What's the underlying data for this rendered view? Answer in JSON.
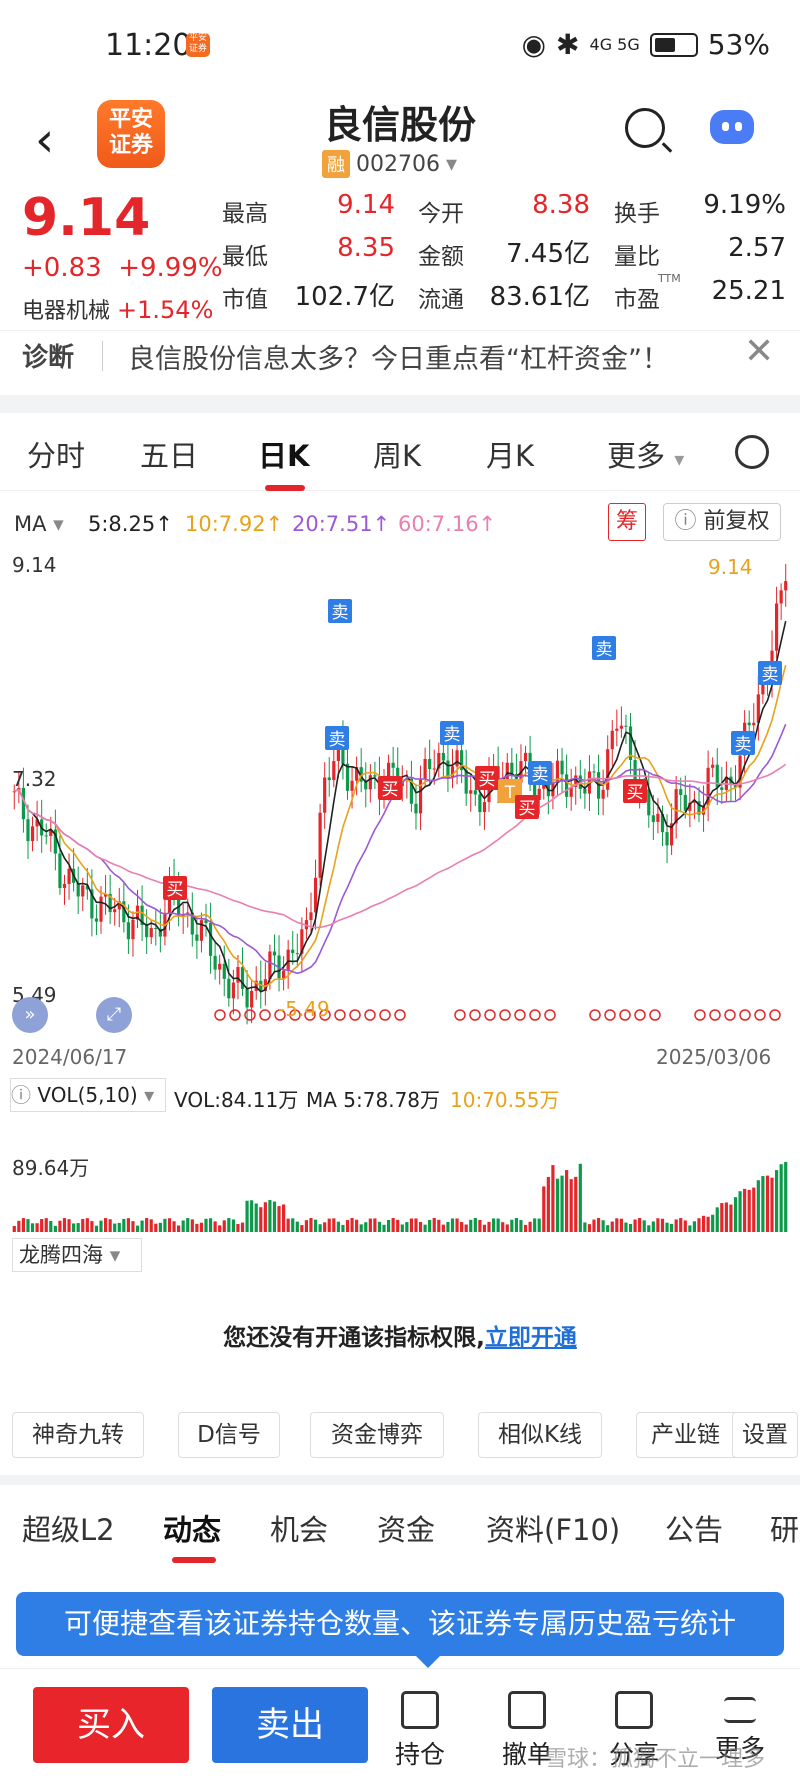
{
  "status_bar": {
    "time": "11:20",
    "badge": "平安证券",
    "network": "4G 5G",
    "battery": "53%"
  },
  "header": {
    "back_icon": "back-arrow-icon",
    "app_logo": "平安\n证券",
    "stock_name": "良信股份",
    "rong_badge": "融",
    "stock_code": "002706",
    "search_icon": "search-icon",
    "assistant_icon": "robot-icon"
  },
  "quote": {
    "price": "9.14",
    "change": "+0.83",
    "change_pct": "+9.99%",
    "sector_name": "电器机械",
    "sector_change": "+1.54%",
    "fields": [
      {
        "label": "最高",
        "value": "9.14",
        "color": "red"
      },
      {
        "label": "今开",
        "value": "8.38",
        "color": "red"
      },
      {
        "label": "换手",
        "value": "9.19%",
        "color": "dark"
      },
      {
        "label": "最低",
        "value": "8.35",
        "color": "red"
      },
      {
        "label": "金额",
        "value": "7.45亿",
        "color": "dark"
      },
      {
        "label": "量比",
        "value": "2.57",
        "color": "dark"
      },
      {
        "label": "市值",
        "value": "102.7亿",
        "color": "dark"
      },
      {
        "label": "流通",
        "value": "83.61亿",
        "color": "dark"
      },
      {
        "label": "市盈",
        "value": "25.21",
        "color": "dark",
        "superscript": "TTM"
      }
    ]
  },
  "diagnosis": {
    "label": "诊断",
    "text": "良信股份信息太多？今日重点看“杠杆资金”！"
  },
  "period_tabs": [
    "分时",
    "五日",
    "日K",
    "周K",
    "月K",
    "更多"
  ],
  "active_period": "日K",
  "ma_legend": {
    "label": "MA",
    "ma5": "5:8.25↑",
    "ma10": "10:7.92↑",
    "ma20": "20:7.51↑",
    "ma60": "60:7.16↑",
    "chip_button": "筹",
    "adjust_button": "前复权"
  },
  "chart_data": {
    "type": "candlestick",
    "x_start": "2024/06/17",
    "x_end": "2025/03/06",
    "y_labels": [
      "9.14",
      "7.32",
      "5.49"
    ],
    "high_marker": "9.14",
    "low_marker": "5.49",
    "signals": [
      "卖",
      "卖",
      "买",
      "卖",
      "买",
      "买",
      "T",
      "买",
      "卖",
      "卖",
      "买",
      "卖",
      "卖"
    ],
    "ma_colors": {
      "ma5": "#222222",
      "ma10": "#e8a21c",
      "ma20": "#9b59d6",
      "ma60": "#e87fb0"
    },
    "close_path": [
      7.2,
      7.0,
      6.9,
      6.6,
      6.4,
      6.3,
      6.25,
      6.2,
      6.1,
      6.0,
      6.35,
      6.2,
      6.05,
      5.8,
      5.55,
      5.5,
      5.6,
      5.75,
      5.85,
      6.0,
      7.3,
      7.6,
      7.4,
      7.3,
      7.45,
      7.35,
      7.25,
      7.5,
      7.6,
      7.4,
      7.2,
      7.35,
      7.5,
      7.45,
      7.3,
      7.35,
      7.4,
      7.3,
      7.35,
      7.9,
      7.6,
      7.1,
      6.9,
      7.2,
      7.1,
      7.4,
      7.3,
      7.55,
      8.0,
      8.5,
      9.14
    ]
  },
  "volume": {
    "legend": "VOL(5,10)",
    "vol": "VOL:84.11万",
    "ma5": "MA 5:78.78万",
    "ma10": "10:70.55万",
    "max_label": "89.64万"
  },
  "indicator": {
    "name": "龙腾四海",
    "locked_text": "您还没有开通该指标权限,",
    "open_link": "立即开通"
  },
  "tool_buttons": [
    "神奇九转",
    "D信号",
    "资金博弈",
    "相似K线",
    "产业链",
    "设置"
  ],
  "bottom_tabs": [
    "超级L2",
    "动态",
    "机会",
    "资金",
    "资料(F10)",
    "公告",
    "研"
  ],
  "active_bottom_tab": "动态",
  "tooltip": "可便捷查看该证券持仓数量、该证券专属历史盈亏统计",
  "bottom_bar": {
    "buy": "买入",
    "sell": "卖出",
    "items": [
      "持仓",
      "撤单",
      "分享",
      "更多"
    ],
    "watermark": "雪球：孤獨不立一理多"
  }
}
